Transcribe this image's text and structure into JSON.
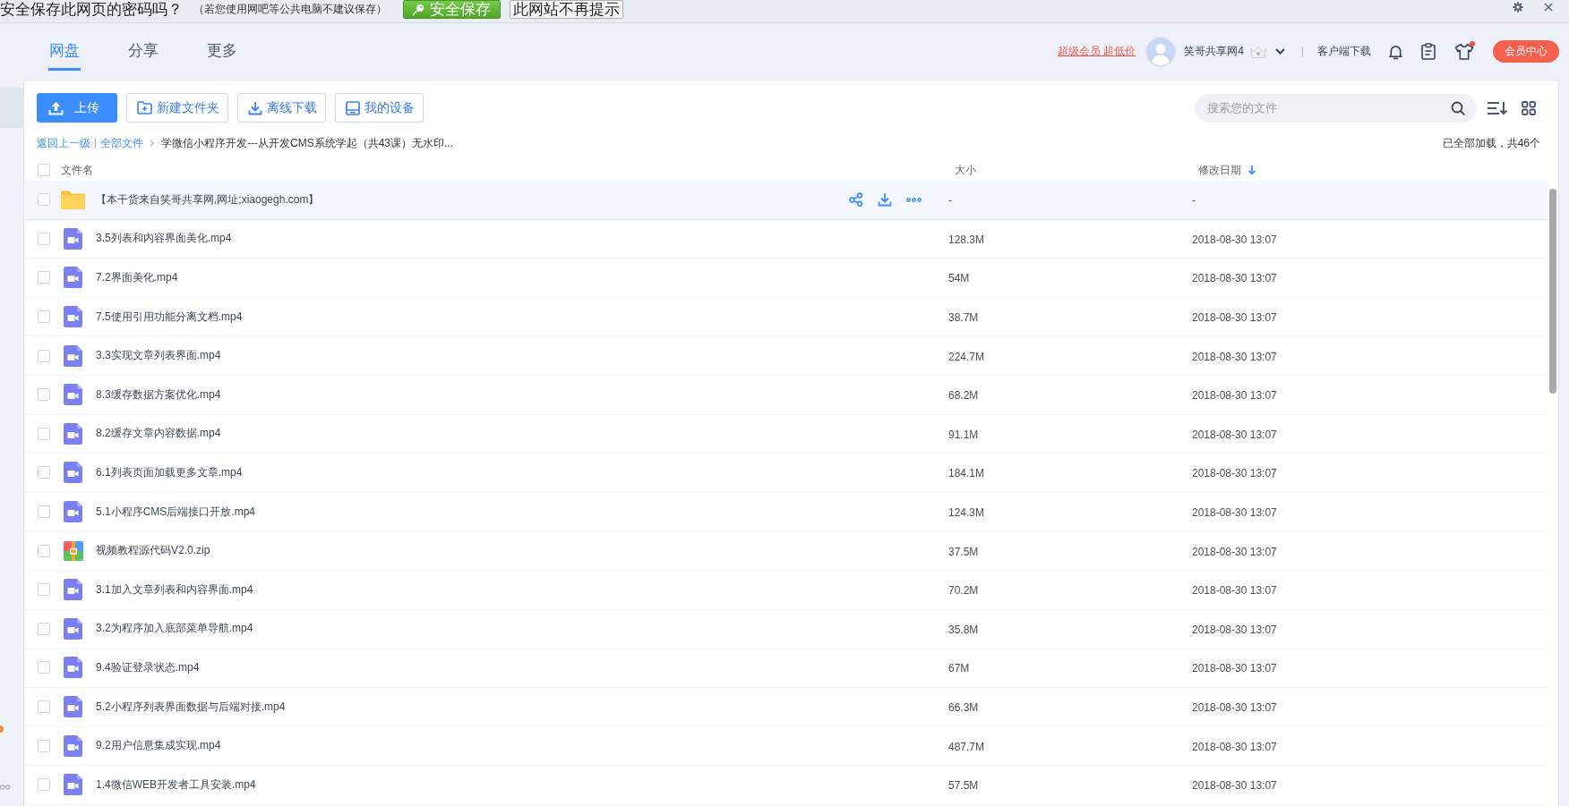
{
  "password_bar": {
    "question": "安全保存此网页的密码吗？",
    "hint": "（若您使用网吧等公共电脑不建议保存）",
    "buttons": [
      {
        "label": "安全保存",
        "kind": "primary"
      },
      {
        "label": "此网站不再提示",
        "kind": "plain"
      }
    ]
  },
  "nav": {
    "tabs": [
      {
        "label": "网盘",
        "selected": true
      },
      {
        "label": "分享",
        "selected": false
      },
      {
        "label": "更多",
        "selected": false
      }
    ]
  },
  "user_bar": {
    "promo_link": "超级会员 超低价",
    "username": "笑哥共享网4",
    "client_download": "客户端下载",
    "notification_dot": true,
    "vip_button": "会员中心"
  },
  "toolbar": {
    "buttons": [
      {
        "label": "上传",
        "kind": "primary"
      },
      {
        "label": "新建文件夹",
        "kind": "outline"
      },
      {
        "label": "离线下载",
        "kind": "outline"
      },
      {
        "label": "我的设备",
        "kind": "outline"
      }
    ],
    "search": {
      "placeholder": "搜索您的文件"
    }
  },
  "breadcrumb": {
    "back": "返回上一级",
    "root": "全部文件",
    "current": "学微信小程序开发---从开发CMS系统学起（共43课）无水印...",
    "status": "已全部加载，共46个"
  },
  "table": {
    "select_all": {
      "checked": false
    },
    "columns": [
      {
        "label": "文件名",
        "sorted": false
      },
      {
        "label": "大小",
        "sorted": false
      },
      {
        "label": "修改日期",
        "sorted": true
      }
    ],
    "rows": [
      {
        "kind": "folder",
        "name": "【本干货来自笑哥共享网,网址;xiaogegh.com】",
        "size": "-",
        "modified": "-",
        "checked": false,
        "hovered": true
      },
      {
        "kind": "video",
        "name": "3.5列表和内容界面美化.mp4",
        "size": "128.3M",
        "modified": "2018-08-30 13:07",
        "checked": false,
        "hovered": false
      },
      {
        "kind": "video",
        "name": "7.2界面美化.mp4",
        "size": "54M",
        "modified": "2018-08-30 13:07",
        "checked": false,
        "hovered": false
      },
      {
        "kind": "video",
        "name": "7.5使用引用功能分离文档.mp4",
        "size": "38.7M",
        "modified": "2018-08-30 13:07",
        "checked": false,
        "hovered": false
      },
      {
        "kind": "video",
        "name": "3.3实现文章列表界面.mp4",
        "size": "224.7M",
        "modified": "2018-08-30 13:07",
        "checked": false,
        "hovered": false
      },
      {
        "kind": "video",
        "name": "8.3缓存数据方案优化.mp4",
        "size": "68.2M",
        "modified": "2018-08-30 13:07",
        "checked": false,
        "hovered": false
      },
      {
        "kind": "video",
        "name": "8.2缓存文章内容数据.mp4",
        "size": "91.1M",
        "modified": "2018-08-30 13:07",
        "checked": false,
        "hovered": false
      },
      {
        "kind": "video",
        "name": "6.1列表页面加载更多文章.mp4",
        "size": "184.1M",
        "modified": "2018-08-30 13:07",
        "checked": false,
        "hovered": false
      },
      {
        "kind": "video",
        "name": "5.1小程序CMS后端接口开放.mp4",
        "size": "124.3M",
        "modified": "2018-08-30 13:07",
        "checked": false,
        "hovered": false
      },
      {
        "kind": "zip",
        "name": "视频教程源代码V2.0.zip",
        "size": "37.5M",
        "modified": "2018-08-30 13:07",
        "checked": false,
        "hovered": false
      },
      {
        "kind": "video",
        "name": "3.1加入文章列表和内容界面.mp4",
        "size": "70.2M",
        "modified": "2018-08-30 13:07",
        "checked": false,
        "hovered": false
      },
      {
        "kind": "video",
        "name": "3.2为程序加入底部菜单导航.mp4",
        "size": "35.8M",
        "modified": "2018-08-30 13:07",
        "checked": false,
        "hovered": false
      },
      {
        "kind": "video",
        "name": "9.4验证登录状态.mp4",
        "size": "67M",
        "modified": "2018-08-30 13:07",
        "checked": false,
        "hovered": false
      },
      {
        "kind": "video",
        "name": "5.2小程序列表界面数据与后端对接.mp4",
        "size": "66.3M",
        "modified": "2018-08-30 13:07",
        "checked": false,
        "hovered": false
      },
      {
        "kind": "video",
        "name": "9.2用户信息集成实现.mp4",
        "size": "487.7M",
        "modified": "2018-08-30 13:07",
        "checked": false,
        "hovered": false
      },
      {
        "kind": "video",
        "name": "1.4微信WEB开发者工具安装.mp4",
        "size": "57.5M",
        "modified": "2018-08-30 13:07",
        "checked": false,
        "hovered": false
      }
    ]
  }
}
